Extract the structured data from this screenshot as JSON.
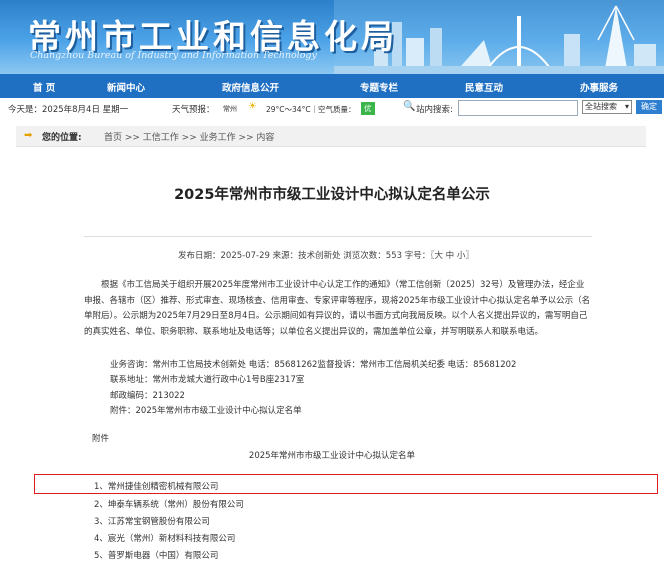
{
  "header": {
    "title": "常州市工业和信息化局",
    "subtitle": "Changzhou Bureau of Industry and Information Technology"
  },
  "nav": {
    "items": [
      "首 页",
      "新闻中心",
      "政府信息公开",
      "专题专栏",
      "民意互动",
      "办事服务"
    ]
  },
  "infobar": {
    "today": "今天是：2025年8月4日 星期一",
    "weather_label": "天气预报：",
    "city": "常州",
    "temp": "29°C～34°C｜空气质量：",
    "air_quality": "优",
    "search_label": "站内搜索:",
    "search_value": "",
    "search_scope": "全站搜索",
    "search_button": "确定"
  },
  "breadcrumb": {
    "label": "您的位置:",
    "path": "首页 >> 工信工作 >> 业务工作 >> 内容"
  },
  "article": {
    "title": "2025年常州市市级工业设计中心拟认定名单公示",
    "meta": "发布日期：2025-07-29  来源：技术创新处  浏览次数：553  字号：〖大 中 小〗",
    "body": "根据《市工信局关于组织开展2025年度常州市工业设计中心认定工作的通知》（常工信创新〔2025〕32号）及管理办法，经企业申报、各辖市（区）推荐、形式审查、现场核查、信用审查、专家评审等程序，现将2025年市级工业设计中心拟认定名单予以公示（名单附后）。公示期为2025年7月29日至8月4日。公示期间如有异议的，请以书面方式向我局反映。以个人名义提出异议的，需写明自己的真实姓名、单位、职务职称、联系地址及电话等；以单位名义提出异议的，需加盖单位公章，并写明联系人和联系电话。",
    "contacts": [
      "业务咨询：常州市工信局技术创新处 电话：85681262监督投诉：常州市工信局机关纪委   电话：85681202",
      "联系地址：常州市龙城大道行政中心1号B座2317室",
      "邮政编码：213022",
      "附件：2025年常州市市级工业设计中心拟认定名单"
    ],
    "attachment_label": "附件",
    "attachment_title": "2025年常州市市级工业设计中心拟认定名单",
    "companies": [
      "1、常州捷佳创精密机械有限公司",
      "2、坤泰车辆系统（常州）股份有限公司",
      "3、江苏常宝钢管股份有限公司",
      "4、宸光（常州）新材料科技有限公司",
      "5、普罗斯电器（中国）有限公司"
    ]
  },
  "colors": {
    "nav_bg": "#1f6fc3",
    "highlight_border": "#d81e1e",
    "air_good": "#39b54a"
  }
}
